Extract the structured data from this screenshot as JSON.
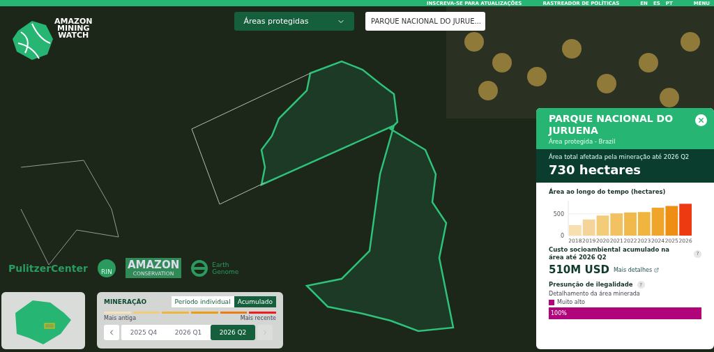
{
  "top_bar": {
    "links": [
      "INSCREVA-SE PARA ATUALIZAÇÕES",
      "RASTREADOR DE POLÍTICAS"
    ],
    "languages": [
      "EN",
      "ES",
      "PT"
    ],
    "menu": "MENU"
  },
  "logo": {
    "lines": [
      "AMAZON",
      "MINING",
      "WATCH"
    ]
  },
  "filters": {
    "category": "Áreas protegidas",
    "area": "PARQUE NACIONAL DO JURUE..."
  },
  "partners": {
    "pulitzer": "PulitzerCenter",
    "rin": "RIN",
    "amazon": "AMAZON",
    "amazon_sub": "CONSERVATION",
    "earth": [
      "Earth",
      "Genome"
    ]
  },
  "legend": {
    "title": "MINERAÇÃO",
    "modes": [
      {
        "label": "Período individual",
        "selected": false
      },
      {
        "label": "Acumulado",
        "selected": true
      }
    ],
    "oldest": "Mais antiga",
    "newest": "Mais recente",
    "periods": [
      {
        "label": "2025 Q4",
        "selected": false
      },
      {
        "label": "2026 Q1",
        "selected": false
      },
      {
        "label": "2026 Q2",
        "selected": true
      }
    ],
    "prev_disabled": false,
    "next_disabled": true
  },
  "panel": {
    "title": "PARQUE NACIONAL DO JURUENA",
    "subtitle": "Área protegida - Brazil",
    "total_label": "Área total afetada pela mineração até 2026 Q2",
    "total_value": "730 hectares",
    "chart_data": {
      "type": "bar",
      "title": "Área ao longo do tempo (hectares)",
      "categories": [
        "2018",
        "2019",
        "2020",
        "2021",
        "2022",
        "2023",
        "2024",
        "2025",
        "2026"
      ],
      "values": [
        240,
        370,
        460,
        510,
        530,
        540,
        640,
        680,
        730
      ],
      "ylim": [
        0,
        800
      ],
      "yticks": [
        0,
        500
      ]
    },
    "help": [
      "?",
      "?"
    ],
    "cost_label": "Custo socioambiental acumulado na área até 2026 Q2",
    "cost_value": "510M USD",
    "cost_link": "Mais detalhes",
    "illegality_title": "Presunção de ilegalidade",
    "illegality_sub": "Detalhamento da área minerada",
    "categories": [
      {
        "label": "Muito alto",
        "color": "#b0047a",
        "share": "100%"
      }
    ]
  }
}
